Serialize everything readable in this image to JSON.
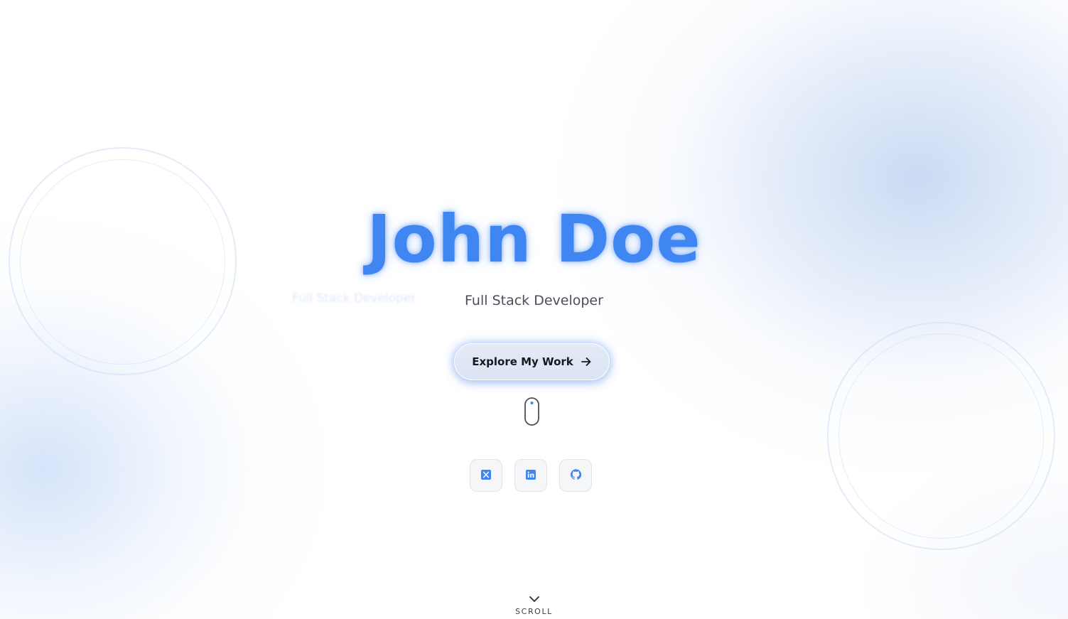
{
  "hero": {
    "name": "John Doe",
    "role": "Full Stack Developer",
    "role_ghost": "Full Stack Developer",
    "cta_label": "Explore My Work",
    "scroll_label": "SCROLL"
  },
  "socials": [
    {
      "name": "x",
      "icon": "x-icon"
    },
    {
      "name": "linkedin",
      "icon": "linkedin-icon"
    },
    {
      "name": "github",
      "icon": "github-icon"
    }
  ],
  "colors": {
    "accent": "#3f86f2",
    "text": "#4a4f58",
    "cta_bg": "#dce4f3"
  }
}
